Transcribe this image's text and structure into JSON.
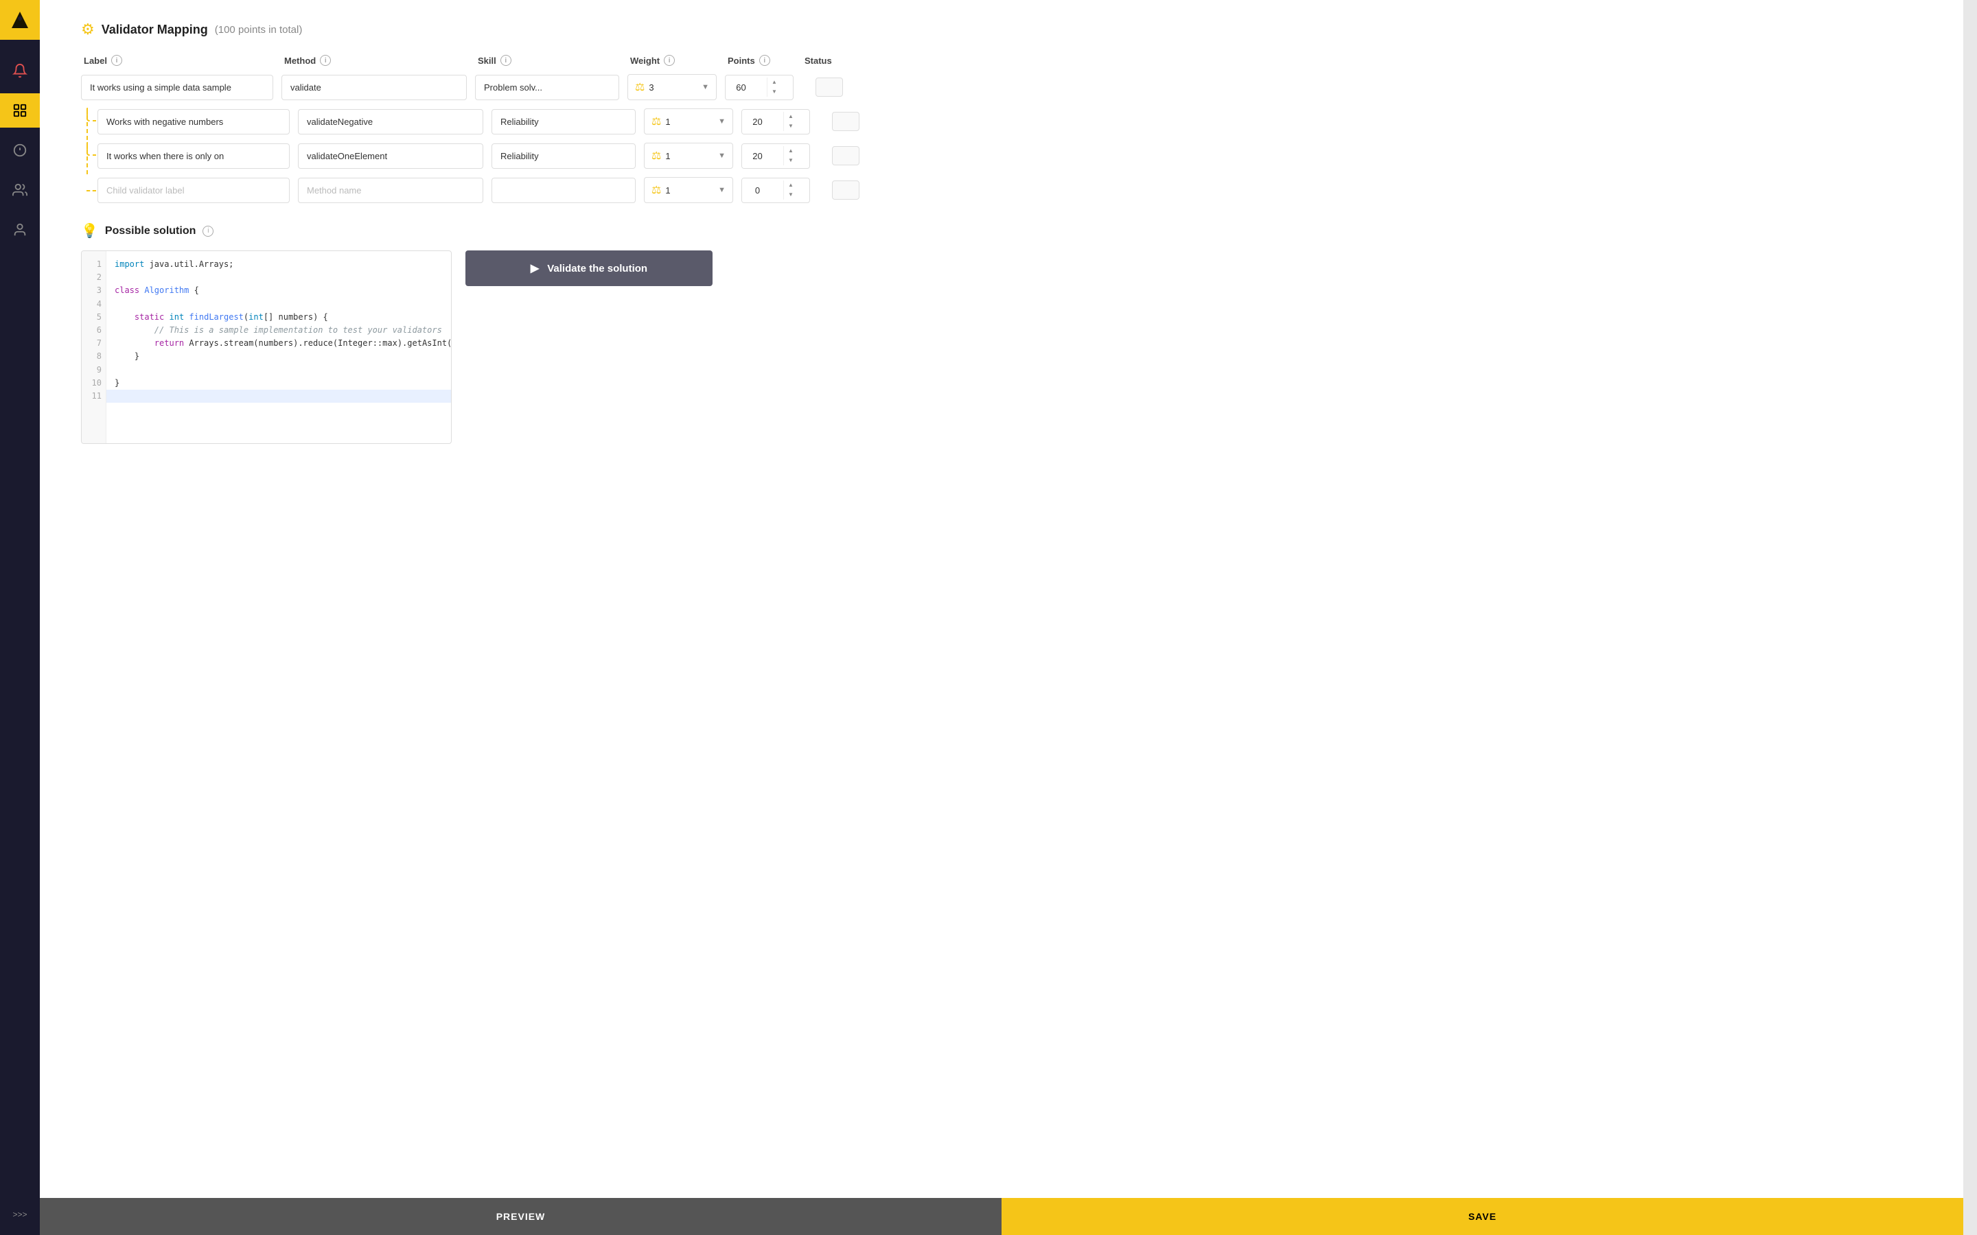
{
  "sidebar": {
    "logo": "⟨/⟩",
    "icons": [
      {
        "id": "bell",
        "symbol": "🔔",
        "active": false
      },
      {
        "id": "chart",
        "symbol": "▦",
        "active": true
      },
      {
        "id": "alert",
        "symbol": "⚠",
        "active": false
      },
      {
        "id": "users",
        "symbol": "👥",
        "active": false
      },
      {
        "id": "user",
        "symbol": "👤",
        "active": false
      }
    ],
    "bottom_icon": ">>>"
  },
  "header": {
    "title": "Validator Mapping",
    "subtitle": "(100 points in total)"
  },
  "columns": {
    "label": "Label",
    "method": "Method",
    "skill": "Skill",
    "weight": "Weight",
    "points": "Points",
    "status": "Status"
  },
  "parent_row": {
    "label": "It works using a simple data sample",
    "method": "validate",
    "skill": "Problem solv...",
    "weight": 3,
    "points": 60
  },
  "child_rows": [
    {
      "label": "Works with negative numbers",
      "method": "validateNegative",
      "skill": "Reliability",
      "weight": 1,
      "points": 20
    },
    {
      "label": "It works when there is only on",
      "method": "validateOneElement",
      "skill": "Reliability",
      "weight": 1,
      "points": 20
    },
    {
      "label": "",
      "label_placeholder": "Child validator label",
      "method": "",
      "method_placeholder": "Method name",
      "skill": "",
      "weight": 1,
      "points": 0
    }
  ],
  "solution": {
    "title": "Possible solution",
    "validate_button": "Validate the solution",
    "code_lines": [
      {
        "num": 1,
        "text": "import java.util.Arrays;",
        "active": false
      },
      {
        "num": 2,
        "text": "",
        "active": false
      },
      {
        "num": 3,
        "text": "class Algorithm {",
        "active": false
      },
      {
        "num": 4,
        "text": "",
        "active": false
      },
      {
        "num": 5,
        "text": "    static int findLargest(int[] numbers) {",
        "active": false
      },
      {
        "num": 6,
        "text": "        // This is a sample implementation to test your validators",
        "active": false,
        "is_comment": true
      },
      {
        "num": 7,
        "text": "        return Arrays.stream(numbers).reduce(Integer::max).getAsInt();",
        "active": false
      },
      {
        "num": 8,
        "text": "    }",
        "active": false
      },
      {
        "num": 9,
        "text": "",
        "active": false
      },
      {
        "num": 10,
        "text": "}",
        "active": false
      },
      {
        "num": 11,
        "text": "",
        "active": true
      }
    ]
  },
  "bottom_bar": {
    "preview_label": "PREVIEW",
    "save_label": "SAVE"
  }
}
